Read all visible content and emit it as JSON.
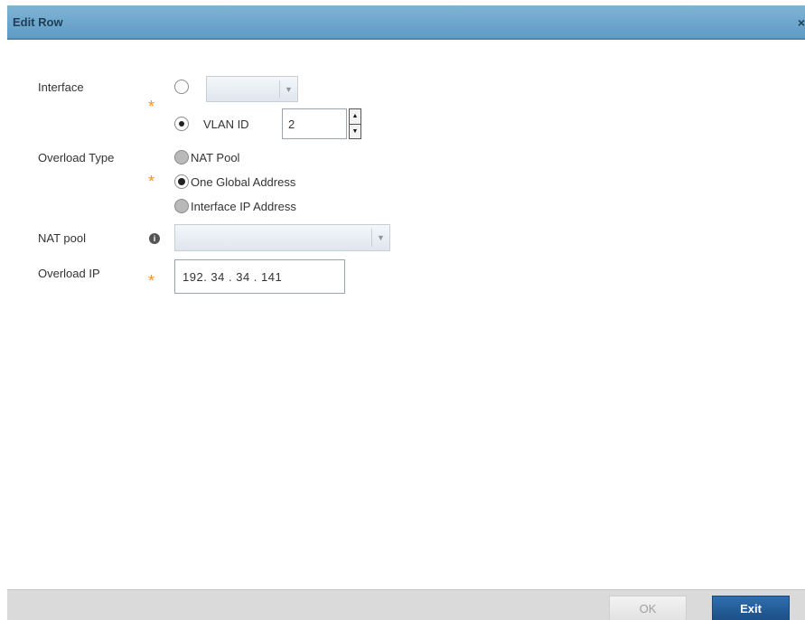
{
  "dialog": {
    "title": "Edit Row",
    "close_glyph": "×"
  },
  "form": {
    "interface": {
      "label": "Interface",
      "required_glyph": "*",
      "option_select_value": "",
      "option_vlan_label": "VLAN ID",
      "vlan_id_value": "2",
      "selected": "vlan"
    },
    "overload_type": {
      "label": "Overload Type",
      "required_glyph": "*",
      "options": [
        "NAT Pool",
        "One Global Address",
        "Interface IP Address"
      ],
      "selected": "One Global Address"
    },
    "nat_pool": {
      "label": "NAT pool",
      "info_glyph": "i",
      "value": ""
    },
    "overload_ip": {
      "label": "Overload IP",
      "required_glyph": "*",
      "value": "192. 34 . 34 . 141"
    }
  },
  "footer": {
    "ok_label": "OK",
    "exit_label": "Exit"
  },
  "colors": {
    "title_bar": "#6ea8cf",
    "required_star": "#f7941d",
    "exit_button": "#22558f"
  }
}
